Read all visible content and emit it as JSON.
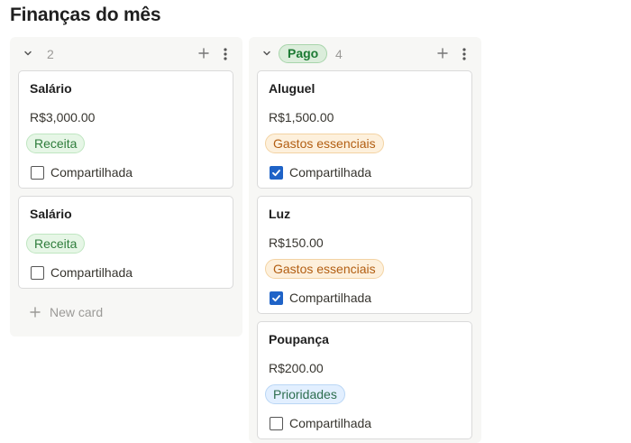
{
  "page": {
    "title": "Finanças do mês"
  },
  "columns": [
    {
      "group_label": "",
      "count": "2",
      "new_card_label": "New card",
      "cards": [
        {
          "title": "Salário",
          "amount": "R$3,000.00",
          "tag": "Receita",
          "checkbox_label": "Compartilhada",
          "checked": false
        },
        {
          "title": "Salário",
          "amount": "",
          "tag": "Receita",
          "checkbox_label": "Compartilhada",
          "checked": false
        }
      ]
    },
    {
      "group_label": "Pago",
      "count": "4",
      "cards": [
        {
          "title": "Aluguel",
          "amount": "R$1,500.00",
          "tag": "Gastos essenciais",
          "checkbox_label": "Compartilhada",
          "checked": true
        },
        {
          "title": "Luz",
          "amount": "R$150.00",
          "tag": "Gastos essenciais",
          "checkbox_label": "Compartilhada",
          "checked": true
        },
        {
          "title": "Poupança",
          "amount": "R$200.00",
          "tag": "Prioridades",
          "checkbox_label": "Compartilhada",
          "checked": false
        }
      ]
    }
  ],
  "colors": {
    "check_blue": "#1f63c7",
    "pill_green": "#dbeddb",
    "tag_receita": "#e6f6e6",
    "tag_gastos": "#fdf0dc",
    "tag_prioridades": "#e2efff"
  },
  "icons": {
    "collapse": "chevron-down-icon",
    "add": "plus-icon",
    "more": "more-vertical-icon",
    "check": "check-icon"
  }
}
